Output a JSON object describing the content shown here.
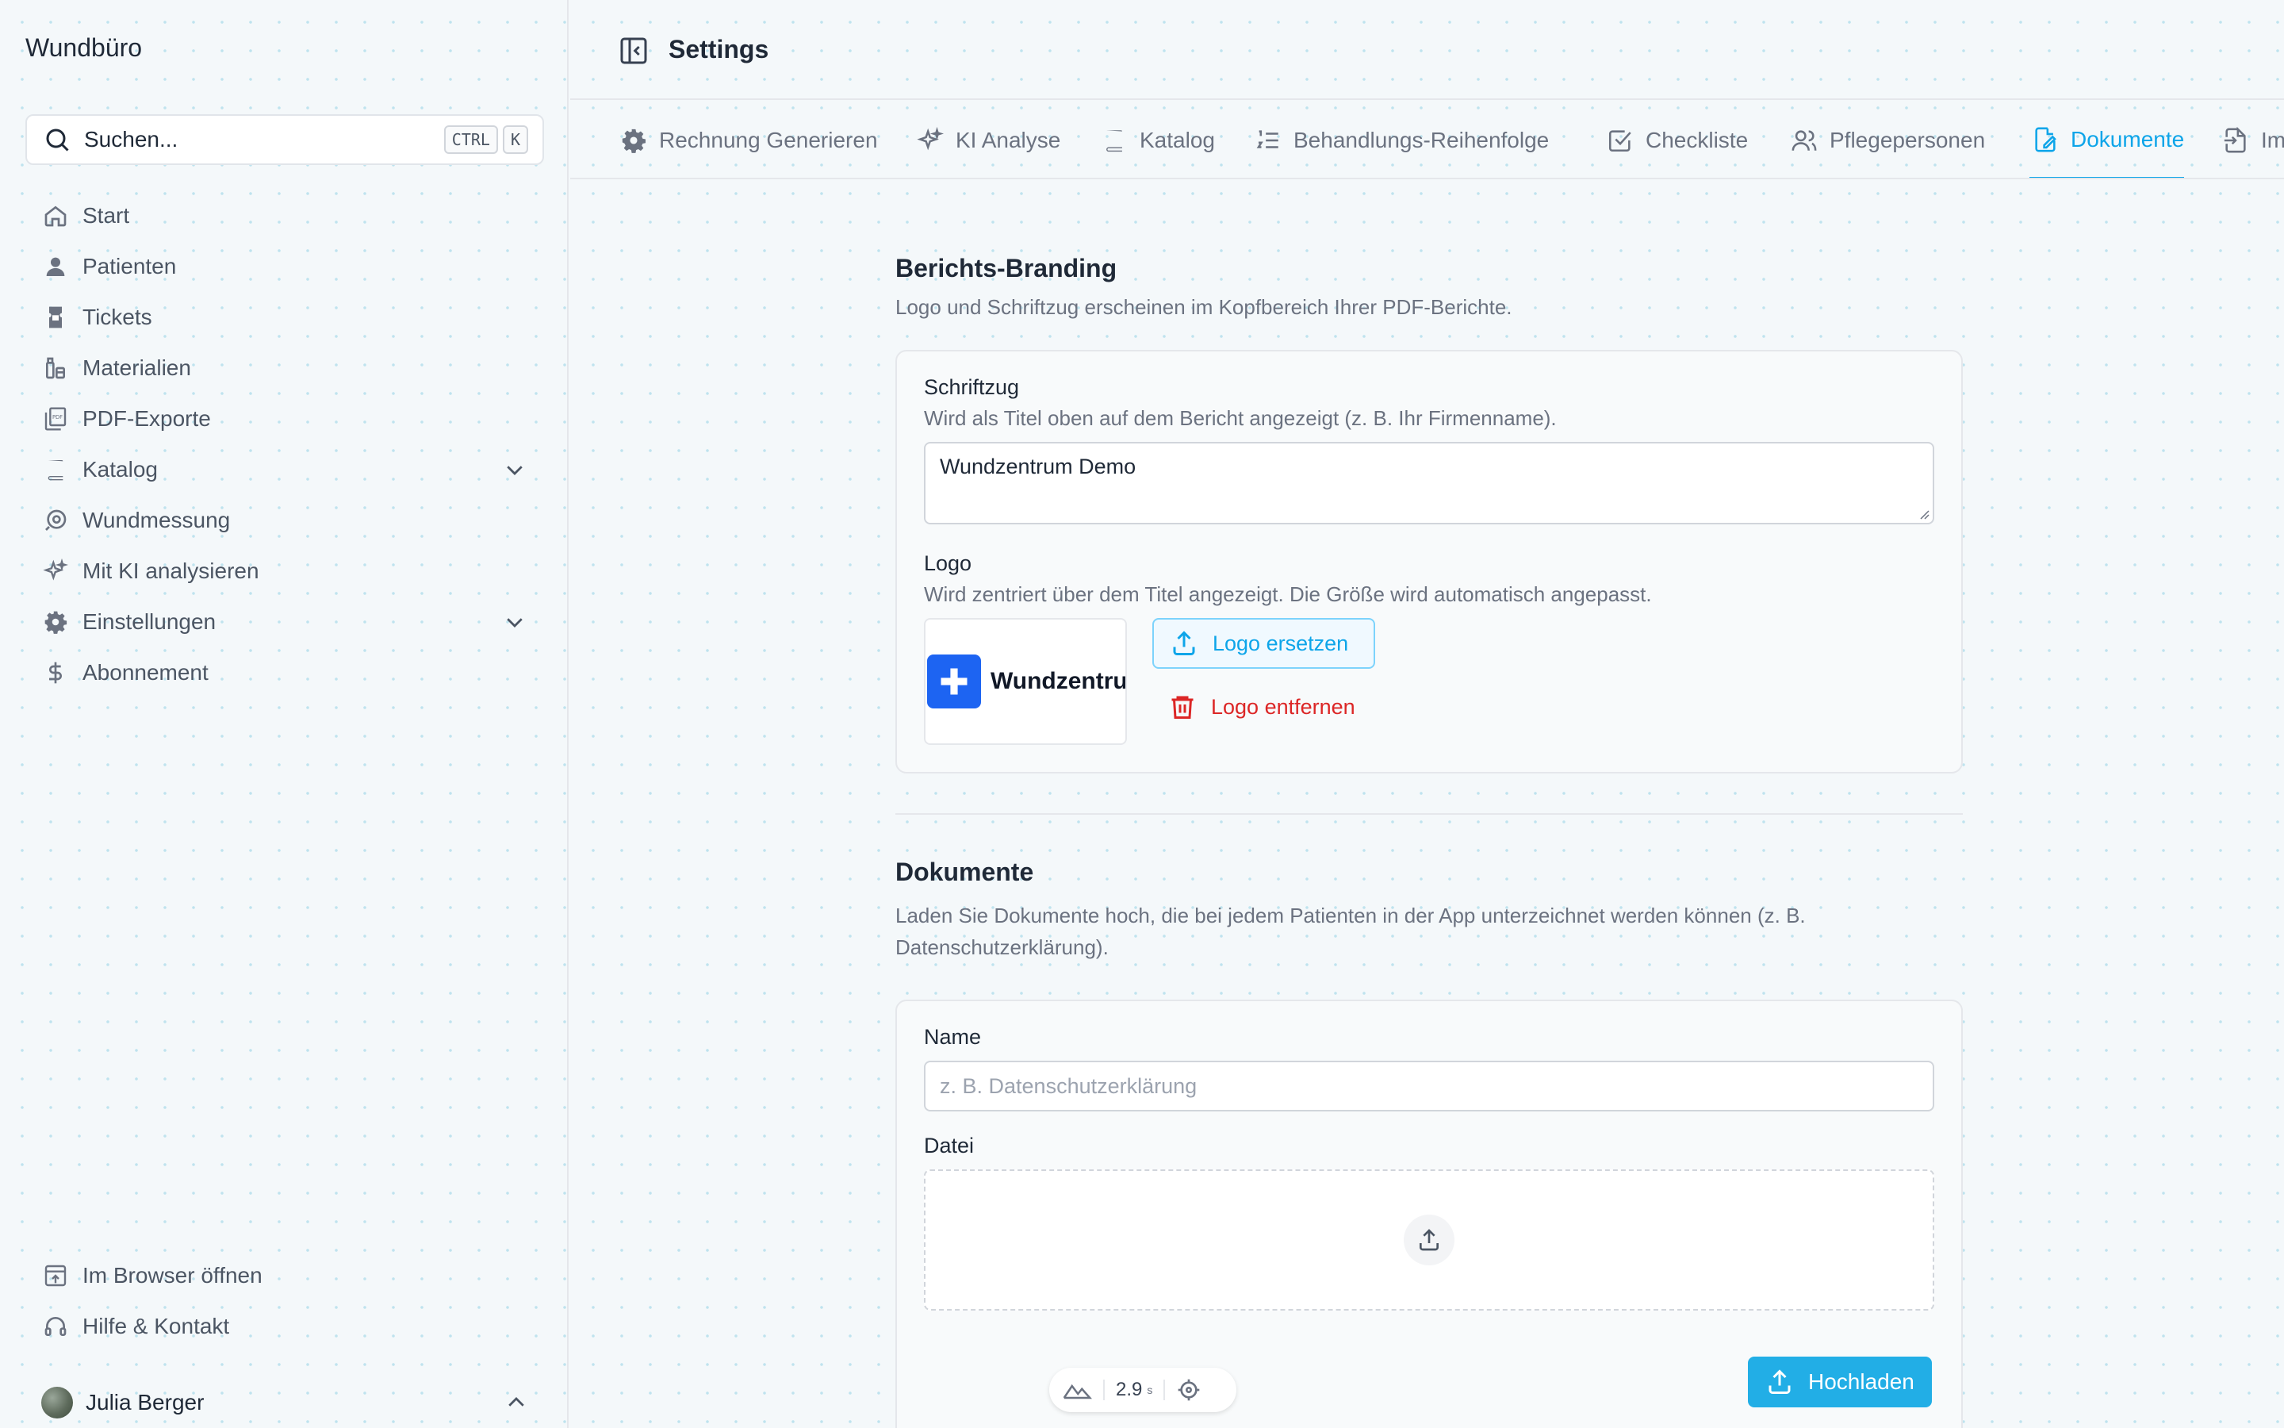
{
  "app": {
    "name": "Wundbüro",
    "page_title": "Settings"
  },
  "search": {
    "placeholder": "Suchen...",
    "shortcut_keys": [
      "CTRL",
      "K"
    ]
  },
  "sidebar": {
    "items": [
      {
        "label": "Start",
        "icon": "home-icon"
      },
      {
        "label": "Patienten",
        "icon": "user-icon"
      },
      {
        "label": "Tickets",
        "icon": "ticket-icon"
      },
      {
        "label": "Materialien",
        "icon": "materials-icon"
      },
      {
        "label": "PDF-Exporte",
        "icon": "pdf-icon"
      },
      {
        "label": "Katalog",
        "icon": "book-icon",
        "expandable": true
      },
      {
        "label": "Wundmessung",
        "icon": "measure-icon"
      },
      {
        "label": "Mit KI analysieren",
        "icon": "sparkles-icon"
      },
      {
        "label": "Einstellungen",
        "icon": "gear-icon",
        "expandable": true
      },
      {
        "label": "Abonnement",
        "icon": "dollar-icon"
      }
    ],
    "bottom_items": [
      {
        "label": "Im Browser öffnen",
        "icon": "browser-icon"
      },
      {
        "label": "Hilfe & Kontakt",
        "icon": "headset-icon"
      }
    ],
    "user": {
      "name": "Julia Berger"
    }
  },
  "tabs": [
    {
      "label": "Rechnung Generieren",
      "icon": "gear-icon"
    },
    {
      "label": "KI Analyse",
      "icon": "sparkles-icon"
    },
    {
      "label": "Katalog",
      "icon": "book-icon"
    },
    {
      "label": "Behandlungs-Reihenfolge",
      "icon": "ordered-list-icon"
    },
    {
      "label": "Checkliste",
      "icon": "checkbox-icon"
    },
    {
      "label": "Pflegepersonen",
      "icon": "users-icon"
    },
    {
      "label": "Dokumente",
      "icon": "document-edit-icon",
      "active": true
    },
    {
      "label": "Im",
      "icon": "file-import-icon"
    }
  ],
  "branding": {
    "title": "Berichts-Branding",
    "description": "Logo und Schriftzug erscheinen im Kopfbereich Ihrer PDF-Berichte.",
    "lettering_label": "Schriftzug",
    "lettering_desc": "Wird als Titel oben auf dem Bericht angezeigt (z. B. Ihr Firmenname).",
    "lettering_value": "Wundzentrum Demo",
    "logo_label": "Logo",
    "logo_desc": "Wird zentriert über dem Titel angezeigt. Die Größe wird automatisch angepasst.",
    "logo_preview_text": "Wundzentrum Demo",
    "replace_label": "Logo ersetzen",
    "remove_label": "Logo entfernen"
  },
  "documents": {
    "title": "Dokumente",
    "description": "Laden Sie Dokumente hoch, die bei jedem Patienten in der App unterzeichnet werden können (z. B. Datenschutzerklärung).",
    "name_label": "Name",
    "name_placeholder": "z. B. Datenschutzerklärung",
    "file_label": "Datei",
    "upload_label": "Hochladen"
  },
  "perf_widget": {
    "value": "2.9",
    "unit": "s"
  },
  "colors": {
    "accent": "#0ea5e9",
    "danger": "#dc2626",
    "primary_button": "#22aee6",
    "logo_blue": "#1d64f2"
  }
}
